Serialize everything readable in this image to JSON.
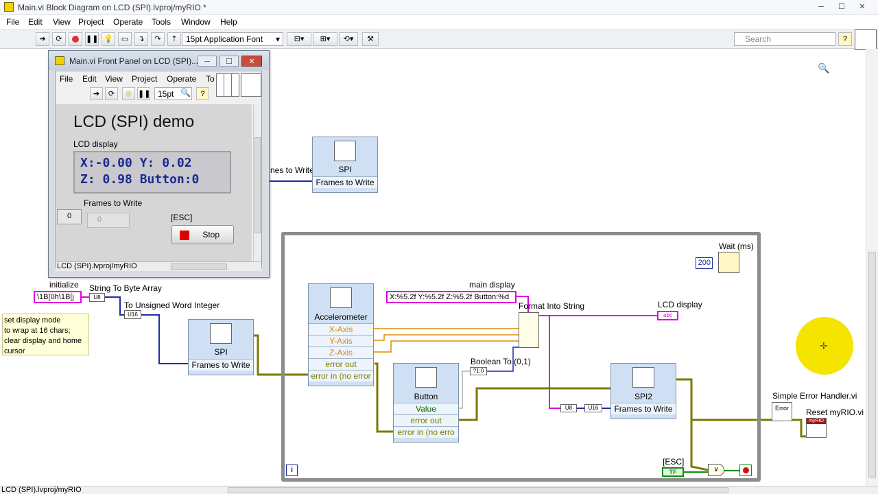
{
  "window": {
    "title": "Main.vi Block Diagram on LCD (SPI).lvproj/myRIO *"
  },
  "menu": [
    "File",
    "Edit",
    "View",
    "Project",
    "Operate",
    "Tools",
    "Window",
    "Help"
  ],
  "toolbar": {
    "font": "15pt Application Font",
    "search_placeholder": "Search"
  },
  "front_panel": {
    "title": "Main.vi Front Panel on LCD (SPI)....",
    "menu": [
      "File",
      "Edit",
      "View",
      "Project",
      "Operate",
      "To"
    ],
    "font": "15pt",
    "heading": "LCD (SPI) demo",
    "lcd_label": "LCD display",
    "lcd_line1": "X:-0.00 Y: 0.02",
    "lcd_line2": "Z: 0.98 Button:0",
    "frames_label": "Frames to Write",
    "frames_index": "0",
    "frames_value": "0",
    "esc_label": "[ESC]",
    "stop_label": "Stop",
    "status": "LCD (SPI).lvproj/myRIO"
  },
  "diagram": {
    "frames_partial": "nes to Write",
    "spi_top": {
      "title": "SPI",
      "row": "Frames to Write"
    },
    "initialize_label": "initialize",
    "initialize_value": "\\1B[0h\\1B[j",
    "string_to_byte": "String To Byte Array",
    "to_u16": "To Unsigned Word Integer",
    "comment": "set display mode\nto wrap at 16 chars;\nclear display and home\ncursor",
    "spi_left": {
      "title": "SPI",
      "row": "Frames to Write"
    },
    "accelerometer": {
      "title": "Accelerometer",
      "rows": [
        "X-Axis",
        "Y-Axis",
        "Z-Axis",
        "error out",
        "error in (no error"
      ]
    },
    "button": {
      "title": "Button",
      "rows": [
        "Value",
        "error out",
        "error in (no erro"
      ]
    },
    "main_display_label": "main display",
    "format_const": "X:%5.2f Y:%5.2f Z:%5.2f Button:%d",
    "format_into_string": "Format Into String",
    "lcd_display_label": "LCD display",
    "boolean_to": "Boolean To (0,1)",
    "spi2": {
      "title": "SPI2",
      "row": "Frames to Write"
    },
    "wait_label": "Wait (ms)",
    "wait_value": "200",
    "esc_label": "[ESC]",
    "tf": "TF",
    "simple_error": "Simple Error Handler.vi",
    "reset": "Reset myRIO.vi",
    "myrio_tag": "myRIO",
    "u16a": "U16",
    "u16b": "U16",
    "u8": "U8",
    "abc": "abc",
    "loop_index": "i",
    "err_glyph": "Error"
  },
  "status": {
    "project": "LCD (SPI).lvproj/myRIO"
  }
}
